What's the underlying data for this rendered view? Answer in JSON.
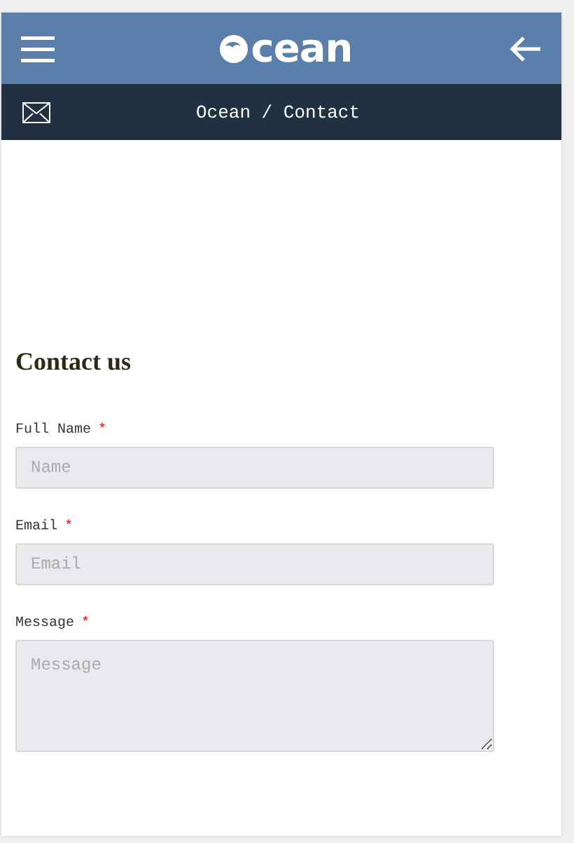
{
  "header": {
    "logo_text": "cean"
  },
  "breadcrumb": {
    "text": "Ocean / Contact"
  },
  "form": {
    "title": "Contact us",
    "required_mark": "*",
    "fields": [
      {
        "kind": "input",
        "label": "Full Name",
        "required": true,
        "placeholder": "Name"
      },
      {
        "kind": "input",
        "label": "Email",
        "required": true,
        "placeholder": "Email"
      },
      {
        "kind": "textarea",
        "label": "Message",
        "required": true,
        "placeholder": "Message"
      }
    ]
  }
}
